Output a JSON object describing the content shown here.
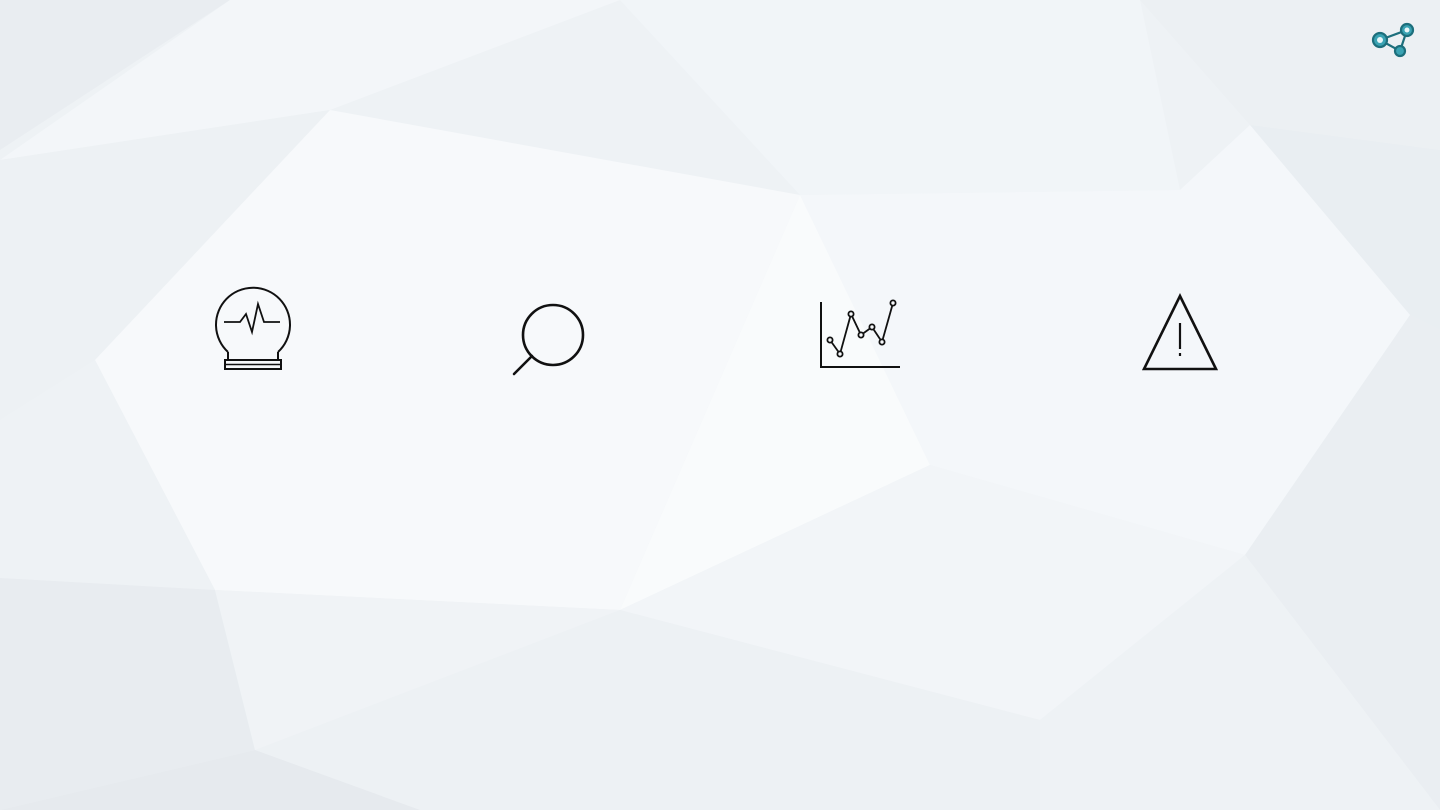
{
  "slide": {
    "background_color": "#f1f4f7",
    "accent_color": "#2a8e9e"
  },
  "logo": {
    "icon": "network-nodes-logo"
  },
  "icons": [
    {
      "name": "crystal-ball-pulse-icon"
    },
    {
      "name": "magnifier-search-icon"
    },
    {
      "name": "line-chart-icon"
    },
    {
      "name": "warning-triangle-icon"
    }
  ]
}
